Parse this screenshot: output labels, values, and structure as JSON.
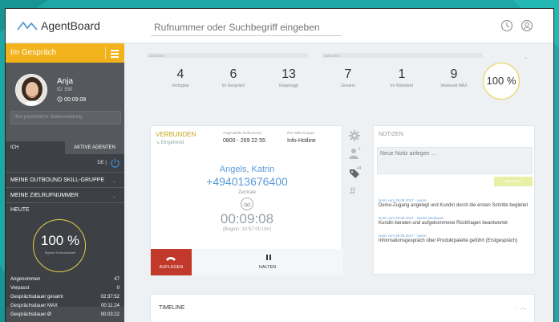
{
  "app": {
    "name": "AgentBoard"
  },
  "search": {
    "placeholder": "Rufnummer oder Suchbegriff eingeben"
  },
  "header_icons": [
    "clock-icon",
    "user-icon"
  ],
  "sidebar": {
    "status": "Im Gespräch",
    "agent": {
      "name": "Anja",
      "id": "ID: 530",
      "timer": "00:09:08"
    },
    "status_message_placeholder": "Ihre persönliche Statusmeldung",
    "tabs": {
      "me": "ICH",
      "active_agents": "AKTIVE AGENTEN"
    },
    "lang": "DE",
    "sections": [
      "MEINE OUTBOUND SKILL-GRUPPE",
      "MEINE ZIELRUFNUMMER"
    ],
    "today": {
      "title": "HEUTE",
      "percent": "100 %",
      "percent_label": "Eigene Erreichbarkeit",
      "stats": [
        {
          "label": "Angenommen",
          "value": "47"
        },
        {
          "label": "Verpasst",
          "value": "0"
        },
        {
          "label": "Gesprächsdauer gesamt",
          "value": "02:37:52"
        },
        {
          "label": "Gesprächsdauer MAX",
          "value": "00:11:24"
        },
        {
          "label": "Gesprächsdauer Ø",
          "value": "00:03:22"
        }
      ]
    }
  },
  "kpis": {
    "agents_header": "AGENTEN",
    "callers_header": "ANRUFER",
    "agents": [
      {
        "value": "4",
        "label": "Verfügbar"
      },
      {
        "value": "6",
        "label": "Im Gespräch"
      },
      {
        "value": "13",
        "label": "Eingeloggt"
      }
    ],
    "callers": [
      {
        "value": "7",
        "label": "Gesamt"
      },
      {
        "value": "1",
        "label": "Im Warteteld"
      },
      {
        "value": "9",
        "label": "Wartezeit MAX"
      }
    ],
    "service_level": "100 %"
  },
  "call": {
    "state": "VERBUNDEN",
    "direction": "Eingehend",
    "dialed_label": "Angewählte Rufnummer",
    "dialed_value": "0800 - 269 22 55",
    "group_label": "Ihre Skill-Gruppe",
    "group_value": "Info-Hotline",
    "caller_name": "Angels, Katrin",
    "caller_number": "+494013676400",
    "caller_sub": "Zentrale",
    "duration": "00:09:08",
    "begin": "(Beginn: 10:57:00 Uhr)",
    "hangup_label": "AUFLEGEN",
    "hold_label": "HALTEN"
  },
  "side_icon_names": [
    "gear-icon",
    "person-icon",
    "tag-icon",
    "hash-icon"
  ],
  "notes": {
    "title": "NOTIZEN",
    "input_placeholder": "Neue Notiz anlegen ...",
    "save_label": "Speichern",
    "items": [
      {
        "meta": "Notiz vom 29.05.2017 - Aaron",
        "text": "Demo-Zugang angelegt und Kundin durch die ersten Schritte begleitet"
      },
      {
        "meta": "Notiz vom 20.05.2017 - Daniel Neubauer",
        "text": "Kundin beraten und aufgekommene Rückfragen beantwortet"
      },
      {
        "meta": "Notiz vom 29.05.2017 - Aaron",
        "text": "Informationsgespräch über Produktpalette geführt (Erstgespräch)"
      }
    ]
  },
  "timeline": {
    "title": "TIMELINE"
  },
  "colors": {
    "accent": "#f2b21b",
    "sidebar": "#4a4d51",
    "call_blue": "#5a9ad8",
    "hangup_red": "#c0392b",
    "background": "#1fa6a6"
  }
}
